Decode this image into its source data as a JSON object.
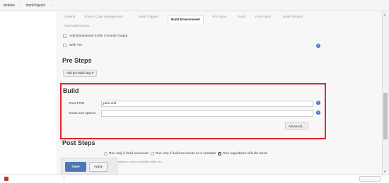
{
  "breadcrumb": {
    "items": [
      "Jenkins",
      "mvnProjects"
    ],
    "separator": "›"
  },
  "tabs": [
    "General",
    "Source Code Management",
    "Build Triggers",
    "Build Environment",
    "Pre Steps",
    "Build",
    "Post Steps",
    "Build Settings",
    "Post-build Actions"
  ],
  "active_tab": "Build Environment",
  "build_env": {
    "timestamps_label": "Add timestamps to the Console Output",
    "with_ant_label": "With Ant"
  },
  "pre_steps": {
    "title": "Pre Steps",
    "add_button": "Add pre-build step ▾"
  },
  "build": {
    "title": "Build",
    "root_pom_label": "Root POM",
    "root_pom_value": "pom.xml",
    "goals_label": "Goals and options",
    "goals_value": "",
    "advanced_button": "Advanced..."
  },
  "post_steps": {
    "title": "Post Steps",
    "options": [
      "Run only if build succeeds",
      "Run only if build succeeds or is unstable",
      "Run regardless of build result"
    ],
    "selected_index": 2,
    "note": "t postbuild steps run only for successful builds, etc."
  },
  "actions": {
    "save": "Save",
    "apply": "Apply"
  },
  "colors": {
    "highlight_border": "#e0262c",
    "save_button": "#4b78b4",
    "help_icon": "#4a72c4"
  }
}
